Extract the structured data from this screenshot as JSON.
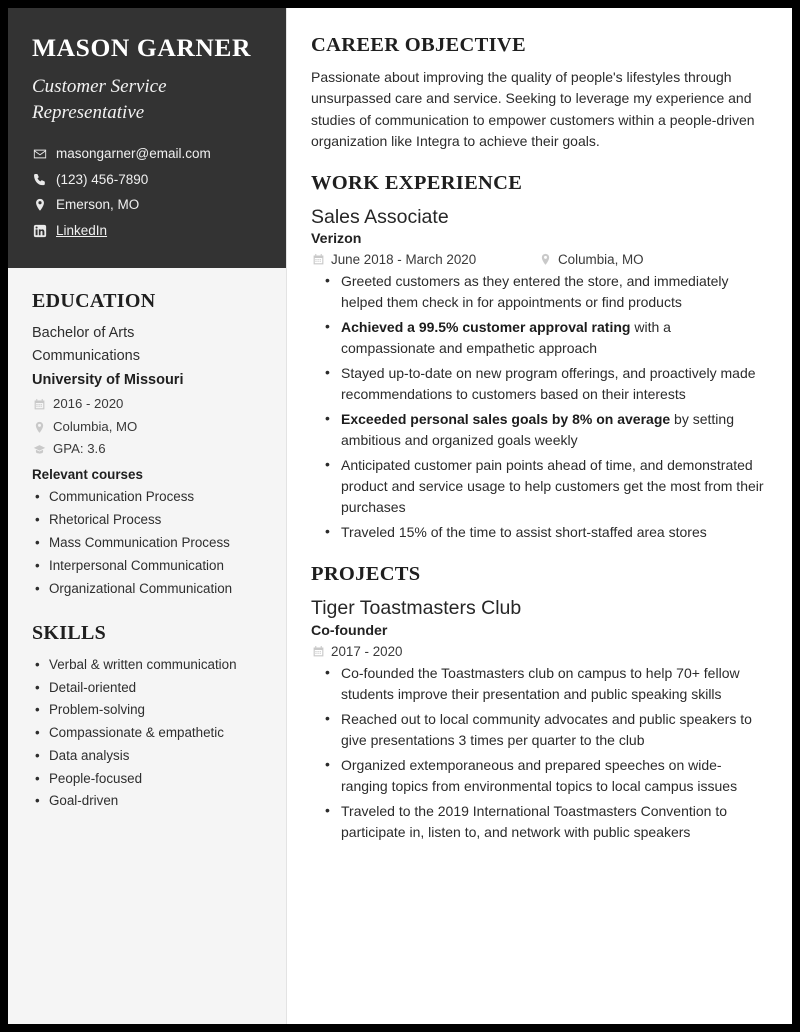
{
  "header": {
    "name": "MASON GARNER",
    "title": "Customer Service Representative",
    "contacts": [
      {
        "icon": "envelope-icon",
        "text": "masongarner@email.com",
        "link": false
      },
      {
        "icon": "phone-icon",
        "text": "(123) 456-7890",
        "link": false
      },
      {
        "icon": "map-pin-icon",
        "text": "Emerson, MO",
        "link": false
      },
      {
        "icon": "linkedin-icon",
        "text": "LinkedIn",
        "link": true
      }
    ]
  },
  "education": {
    "heading": "EDUCATION",
    "degree": "Bachelor of Arts",
    "field": "Communications",
    "school": "University of Missouri",
    "dates": "2016 - 2020",
    "location": "Columbia, MO",
    "gpa": "GPA: 3.6",
    "courses_heading": "Relevant courses",
    "courses": [
      "Communication Process",
      "Rhetorical Process",
      "Mass Communication Process",
      "Interpersonal Communication",
      "Organizational Communication"
    ]
  },
  "skills": {
    "heading": "SKILLS",
    "items": [
      "Verbal & written communication",
      "Detail-oriented",
      "Problem-solving",
      "Compassionate & empathetic",
      "Data analysis",
      "People-focused",
      "Goal-driven"
    ]
  },
  "objective": {
    "heading": "CAREER OBJECTIVE",
    "text": "Passionate about improving the quality of people's lifestyles through unsurpassed care and service. Seeking to leverage my experience and studies of communication to empower customers within a people-driven organization like Integra to achieve their goals."
  },
  "work": {
    "heading": "WORK EXPERIENCE",
    "entries": [
      {
        "title": "Sales Associate",
        "org": "Verizon",
        "dates": "June 2018 - March 2020",
        "location": "Columbia, MO",
        "bullets": [
          {
            "bold": "",
            "rest": "Greeted customers as they entered the store, and immediately helped them check in for appointments or find products"
          },
          {
            "bold": "Achieved a 99.5% customer approval rating",
            "rest": " with a compassionate and empathetic approach"
          },
          {
            "bold": "",
            "rest": "Stayed up-to-date on new program offerings, and proactively made recommendations to customers based on their interests"
          },
          {
            "bold": "Exceeded personal sales goals by 8% on average",
            "rest": " by setting ambitious and organized goals weekly"
          },
          {
            "bold": "",
            "rest": "Anticipated customer pain points ahead of time, and demonstrated product and service usage to help customers get the most from their purchases"
          },
          {
            "bold": "",
            "rest": "Traveled 15% of the time to assist short-staffed area stores"
          }
        ]
      }
    ]
  },
  "projects": {
    "heading": "PROJECTS",
    "entries": [
      {
        "title": "Tiger Toastmasters Club",
        "org": "Co-founder",
        "dates": "2017 - 2020",
        "location": "",
        "bullets": [
          {
            "bold": "",
            "rest": "Co-founded the Toastmasters club on campus to help 70+ fellow students improve their presentation and public speaking skills"
          },
          {
            "bold": "",
            "rest": "Reached out to local community advocates and public speakers to give presentations 3 times per quarter to the club"
          },
          {
            "bold": "",
            "rest": "Organized extemporaneous and prepared speeches on wide-ranging topics from environmental topics to local campus issues"
          },
          {
            "bold": "",
            "rest": "Traveled to the 2019 International Toastmasters Convention to participate in, listen to, and network with public speakers"
          }
        ]
      }
    ]
  },
  "colors": {
    "header_bg": "#333333",
    "sidebar_bg": "#f5f5f5",
    "page_bg": "#ffffff",
    "border": "#000000",
    "text_dark": "#2b2b2b",
    "icon_gray": "#c9c9c9"
  }
}
